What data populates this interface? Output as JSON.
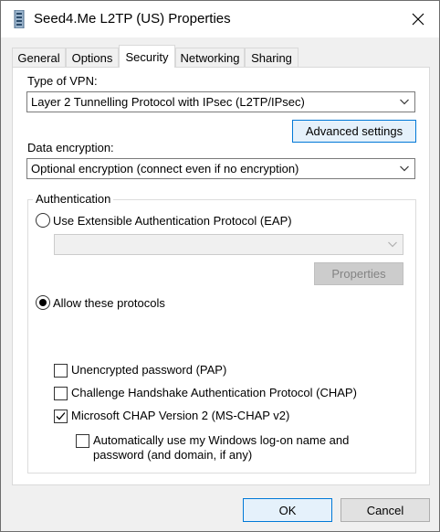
{
  "window": {
    "title": "Seed4.Me L2TP (US) Properties"
  },
  "tabs": [
    {
      "label": "General"
    },
    {
      "label": "Options"
    },
    {
      "label": "Security",
      "active": true
    },
    {
      "label": "Networking"
    },
    {
      "label": "Sharing"
    }
  ],
  "security": {
    "vpn_type_label": "Type of VPN:",
    "vpn_type_value": "Layer 2 Tunnelling Protocol with IPsec (L2TP/IPsec)",
    "advanced_settings_label": "Advanced settings",
    "data_encryption_label": "Data encryption:",
    "data_encryption_value": "Optional encryption (connect even if no encryption)",
    "authentication": {
      "title": "Authentication",
      "eap_label": "Use Extensible Authentication Protocol (EAP)",
      "eap_selected": false,
      "eap_combo_value": "",
      "properties_label": "Properties",
      "allow_protocols_label": "Allow these protocols",
      "allow_protocols_selected": true,
      "protocols": [
        {
          "label": "Unencrypted password (PAP)",
          "checked": false
        },
        {
          "label": "Challenge Handshake Authentication Protocol (CHAP)",
          "checked": false
        },
        {
          "label": "Microsoft CHAP Version 2 (MS-CHAP v2)",
          "checked": true
        }
      ],
      "auto_logon_line1": "Automatically use my Windows log-on name and",
      "auto_logon_line2": "password (and domain, if any)",
      "auto_logon_checked": false
    }
  },
  "footer": {
    "ok_label": "OK",
    "cancel_label": "Cancel"
  },
  "colors": {
    "focus_border": "#0078d7",
    "panel_bg": "#ffffff",
    "dialog_bg": "#f0f0f0"
  },
  "icons": {
    "title": "vpn-network-icon",
    "close": "close-icon",
    "dropdown": "chevron-down-icon"
  }
}
